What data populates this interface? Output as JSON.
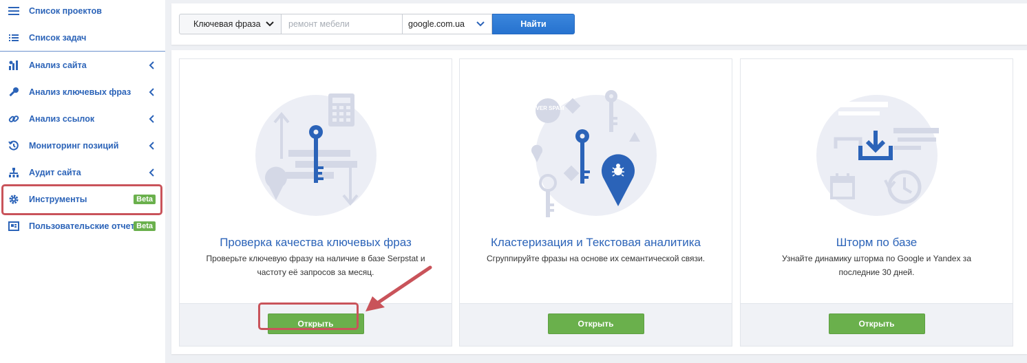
{
  "sidebar": {
    "items": [
      {
        "label": "Список проектов",
        "icon": "menu-icon"
      },
      {
        "label": "Список задач",
        "icon": "list-icon"
      },
      {
        "label": "Анализ сайта",
        "icon": "chart-icon"
      },
      {
        "label": "Анализ ключевых фраз",
        "icon": "key-icon"
      },
      {
        "label": "Анализ ссылок",
        "icon": "link-icon"
      },
      {
        "label": "Мониторинг позиций",
        "icon": "history-icon"
      },
      {
        "label": "Аудит сайта",
        "icon": "sitemap-icon"
      },
      {
        "label": "Инструменты",
        "icon": "gear-icon",
        "badge": "Beta"
      },
      {
        "label": "Пользовательские отчеты",
        "icon": "report-icon",
        "badge": "Beta"
      }
    ]
  },
  "search": {
    "type_label": "Ключевая фраза",
    "placeholder": "ремонт мебели",
    "domain": "google.com.ua",
    "button": "Найти"
  },
  "cards": [
    {
      "title": "Проверка качества ключевых фраз",
      "desc": "Проверьте ключевую фразу на наличие в базе Serpstat и частоту её запросов за месяц.",
      "button": "Открыть"
    },
    {
      "title": "Кластеризация и Текстовая аналитика",
      "desc": "Сгруппируйте фразы на основе их семантической связи.",
      "button": "Открыть",
      "illus_text": "OVER SPAM"
    },
    {
      "title": "Шторм по базе",
      "desc": "Узнайте динамику шторма по Google и Yandex за последние 30 дней.",
      "button": "Открыть"
    }
  ],
  "colors": {
    "link_blue": "#2b63b8",
    "accent_blue": "#2672cf",
    "green": "#6ab04c",
    "highlight_red": "#c9535a"
  }
}
